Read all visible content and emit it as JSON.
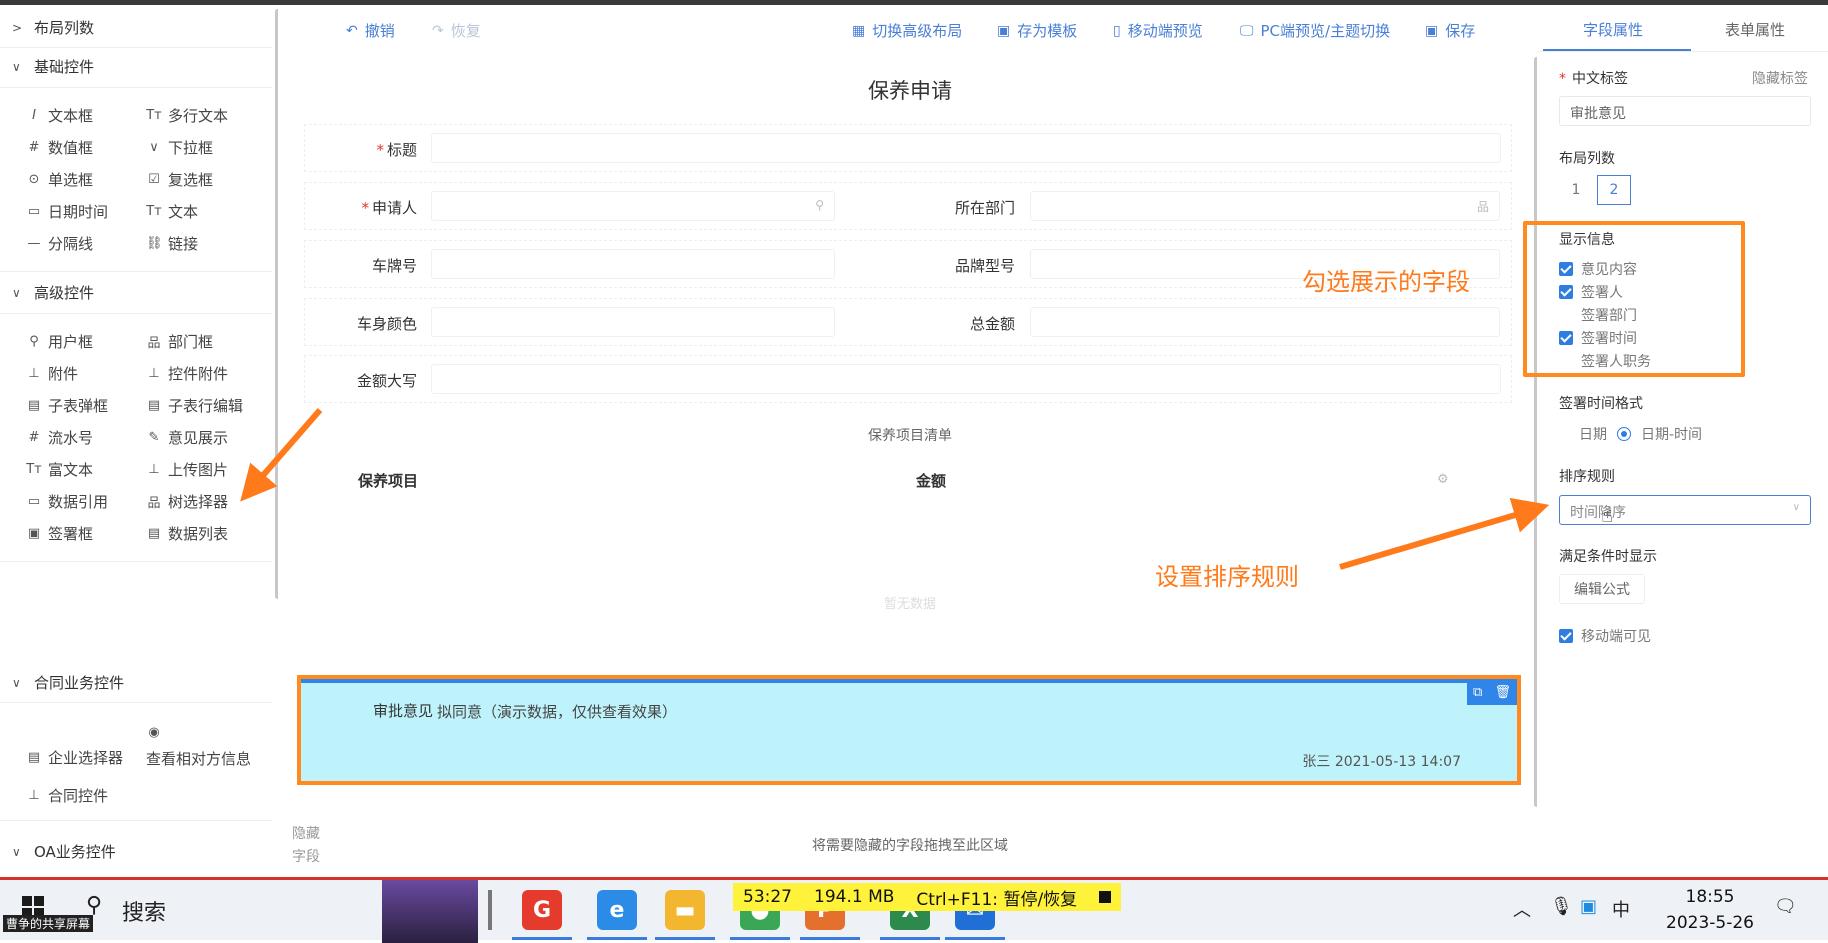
{
  "sidebar": {
    "sections": {
      "layout": "布局列数",
      "basic": "基础控件",
      "advanced": "高级控件",
      "contract": "合同业务控件",
      "oa": "OA业务控件"
    },
    "basic_controls": [
      "文本框",
      "多行文本",
      "数值框",
      "下拉框",
      "单选框",
      "复选框",
      "日期时间",
      "文本",
      "分隔线",
      "链接"
    ],
    "advanced_controls": [
      "用户框",
      "部门框",
      "附件",
      "控件附件",
      "子表弹框",
      "子表行编辑",
      "流水号",
      "意见展示",
      "富文本",
      "上传图片",
      "数据引用",
      "树选择器",
      "签署框",
      "数据列表"
    ],
    "contract_controls": [
      "企业选择器",
      "查看相对方信息",
      "合同控件"
    ]
  },
  "toolbar": {
    "undo": "撤销",
    "redo": "恢复",
    "switch_layout": "切换高级布局",
    "save_template": "存为模板",
    "mobile_preview": "移动端预览",
    "pc_preview": "PC端预览/主题切换",
    "save": "保存"
  },
  "form": {
    "title": "保养申请",
    "required_mark": "*",
    "fields": {
      "title": "标题",
      "applicant": "申请人",
      "department": "所在部门",
      "plate": "车牌号",
      "brand": "品牌型号",
      "color": "车身颜色",
      "total": "总金额",
      "amount_upper": "金额大写"
    },
    "subtable": {
      "title": "保养项目清单",
      "col1": "保养项目",
      "col2": "金额",
      "empty": "暂无数据"
    },
    "opinion": {
      "label": "审批意见",
      "value": "拟同意（演示数据，仅供查看效果）",
      "signature": "张三 2021-05-13 14:07"
    },
    "hidden_label": "隐藏字段",
    "hidden_hint": "将需要隐藏的字段拖拽至此区域"
  },
  "rpanel": {
    "tabs": [
      "字段属性",
      "表单属性"
    ],
    "cn_label": "中文标签",
    "hide_label": "隐藏标签",
    "cn_label_value": "审批意见",
    "columns_label": "布局列数",
    "columns_options": [
      "1",
      "2"
    ],
    "columns_selected": "2",
    "display_info": "显示信息",
    "display_options": [
      {
        "label": "意见内容",
        "checked": true
      },
      {
        "label": "签署人",
        "checked": true
      },
      {
        "label": "签署部门",
        "checked": false
      },
      {
        "label": "签署时间",
        "checked": true
      },
      {
        "label": "签署人职务",
        "checked": false
      }
    ],
    "time_format_label": "签署时间格式",
    "time_format_options": [
      "日期",
      "日期-时间"
    ],
    "time_format_selected": "日期-时间",
    "sort_label": "排序规则",
    "sort_value": "时间降序",
    "condition_label": "满足条件时显示",
    "formula_button": "编辑公式",
    "mobile_visible": "移动端可见"
  },
  "annotations": {
    "check_fields": "勾选展示的字段",
    "set_sort": "设置排序规则",
    "color": "#ff7a1a"
  },
  "taskbar": {
    "share_label": "曹争的共享屏幕",
    "search": "搜索",
    "recorder": {
      "time": "53:27",
      "size": "194.1 MB",
      "hotkey": "Ctrl+F11: 暂停/恢复"
    },
    "ime": "中",
    "time": "18:55",
    "date": "2023-5-26"
  }
}
